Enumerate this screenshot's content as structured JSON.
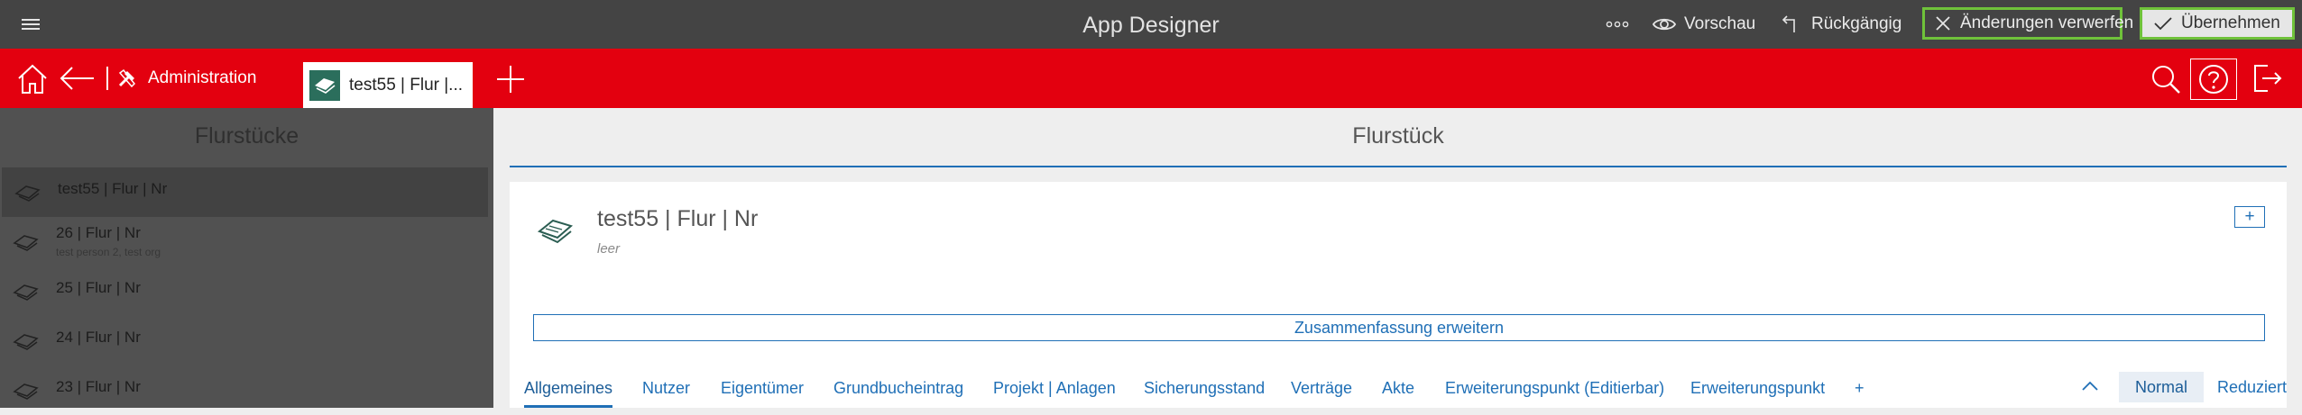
{
  "topbar": {
    "app_title": "App Designer",
    "more_icon": "more-icon",
    "preview_label": "Vorschau",
    "undo_label": "Rückgängig",
    "discard_label": "Änderungen verwerfen",
    "accept_label": "Übernehmen",
    "highlight_color": "#6fc23a"
  },
  "navbar": {
    "background_color": "#e3000f",
    "admin_label": "Administration",
    "open_tab_label": "test55 | Flur |...",
    "icons": [
      "home-icon",
      "back-arrow-icon",
      "tools-icon",
      "plus-icon",
      "search-icon",
      "help-icon",
      "logout-icon"
    ]
  },
  "left_panel": {
    "title": "Flurstücke",
    "items": [
      {
        "title": "test55 | Flur | Nr",
        "subtitle": "",
        "selected": true
      },
      {
        "title": "26 | Flur | Nr",
        "subtitle": "test person 2, test org",
        "selected": false
      },
      {
        "title": "25 | Flur | Nr",
        "subtitle": "",
        "selected": false
      },
      {
        "title": "24 | Flur | Nr",
        "subtitle": "",
        "selected": false
      },
      {
        "title": "23 | Flur | Nr",
        "subtitle": "",
        "selected": false
      }
    ]
  },
  "main": {
    "title": "Flurstück",
    "record": {
      "title": "test55 | Flur | Nr",
      "subtitle": "leer",
      "add_label": "+"
    },
    "expand_label": "Zusammenfassung erweitern",
    "tabs": [
      {
        "label": "Allgemeines",
        "active": true
      },
      {
        "label": "Nutzer",
        "active": false
      },
      {
        "label": "Eigentümer",
        "active": false
      },
      {
        "label": "Grundbucheintrag",
        "active": false
      },
      {
        "label": "Projekt | Anlagen",
        "active": false
      },
      {
        "label": "Sicherungsstand",
        "active": false
      },
      {
        "label": "Verträge",
        "active": false
      },
      {
        "label": "Akte",
        "active": false
      },
      {
        "label": "Erweiterungspunkt (Editierbar)",
        "active": false
      },
      {
        "label": "Erweiterungspunkt",
        "active": false
      },
      {
        "label": "+",
        "active": false
      }
    ],
    "view_modes": {
      "normal_label": "Normal",
      "reduced_label": "Reduziert",
      "selected": "Normal"
    },
    "accent_color": "#1f6fb6"
  }
}
